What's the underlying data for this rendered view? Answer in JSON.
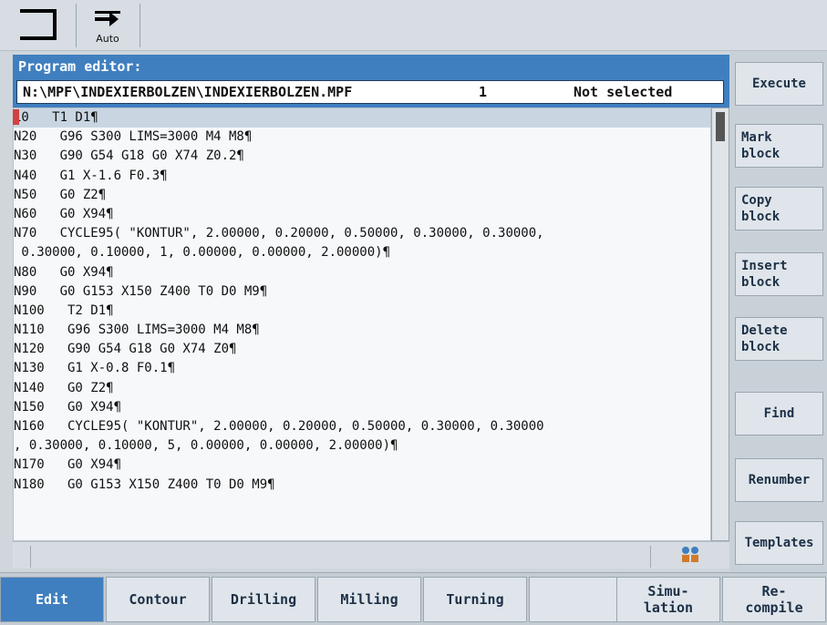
{
  "topbar": {
    "button1_icon": "return-icon",
    "button2_icon": "auto-mode-icon",
    "button2_label": "Auto"
  },
  "editor": {
    "title": "Program editor:",
    "path": "N:\\MPF\\INDEXIERBOLZEN\\INDEXIERBOLZEN.MPF",
    "line_no": "1",
    "selection_state": "Not selected",
    "lines": [
      "10   T1 D1¶",
      "N20   G96 S300 LIMS=3000 M4 M8¶",
      "N30   G90 G54 G18 G0 X74 Z0.2¶",
      "N40   G1 X-1.6 F0.3¶",
      "N50   G0 Z2¶",
      "N60   G0 X94¶",
      "N70   CYCLE95( \"KONTUR\", 2.00000, 0.20000, 0.50000, 0.30000, 0.30000,",
      " 0.30000, 0.10000, 1, 0.00000, 0.00000, 2.00000)¶",
      "N80   G0 X94¶",
      "N90   G0 G153 X150 Z400 T0 D0 M9¶",
      "N100   T2 D1¶",
      "N110   G96 S300 LIMS=3000 M4 M8¶",
      "N120   G90 G54 G18 G0 X74 Z0¶",
      "N130   G1 X-0.8 F0.1¶",
      "N140   G0 Z2¶",
      "N150   G0 X94¶",
      "N160   CYCLE95( \"KONTUR\", 2.00000, 0.20000, 0.50000, 0.30000, 0.30000",
      ", 0.30000, 0.10000, 5, 0.00000, 0.00000, 2.00000)¶",
      "N170   G0 X94¶",
      "N180   G0 G153 X150 Z400 T0 D0 M9¶"
    ]
  },
  "status": {
    "icon": "channel-status-icon"
  },
  "right_softkeys": [
    {
      "label": "Execute"
    },
    {
      "label": "Mark\nblock"
    },
    {
      "label": "Copy\nblock"
    },
    {
      "label": "Insert\nblock"
    },
    {
      "label": "Delete\nblock"
    },
    {
      "label": "Find"
    },
    {
      "label": "Renumber"
    },
    {
      "label": "Templates"
    }
  ],
  "bottom_softkeys": [
    {
      "label": "Edit",
      "active": true
    },
    {
      "label": "Contour"
    },
    {
      "label": "Drilling"
    },
    {
      "label": "Milling"
    },
    {
      "label": "Turning"
    },
    {
      "label": ""
    },
    {
      "label": "Simu-\nlation"
    },
    {
      "label": "Re-\ncompile"
    }
  ],
  "colors": {
    "accent": "#3f7fbf",
    "panel": "#d7dde3",
    "text": "#111111"
  }
}
